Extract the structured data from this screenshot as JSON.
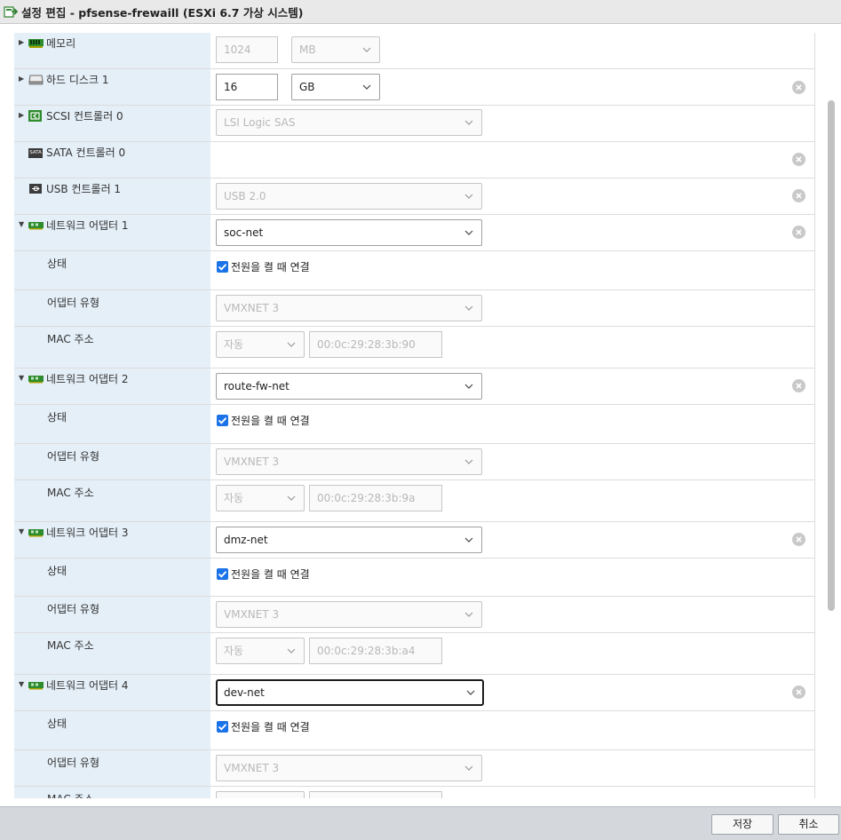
{
  "window": {
    "title": "설정 편집 - pfsense-frewaill (ESXi 6.7 가상 시스템)"
  },
  "hardware": {
    "memory": {
      "label": "메모리",
      "value": "1024",
      "unit": "MB"
    },
    "disk": {
      "label": "하드 디스크 1",
      "value": "16",
      "unit": "GB"
    },
    "scsi": {
      "label": "SCSI 컨트롤러 0",
      "value": "LSI Logic SAS"
    },
    "sata": {
      "label": "SATA 컨트롤러 0",
      "icon_text": "SATA"
    },
    "usb": {
      "label": "USB 컨트롤러 1",
      "value": "USB 2.0"
    }
  },
  "adapters": [
    {
      "label": "네트워크 어댑터 1",
      "network": "soc-net",
      "status_label": "상태",
      "connect_text": "전원을 켤 때 연결",
      "type_label": "어댑터 유형",
      "type": "VMXNET 3",
      "mac_label": "MAC 주소",
      "mac_mode": "자동",
      "mac": "00:0c:29:28:3b:90"
    },
    {
      "label": "네트워크 어댑터 2",
      "network": "route-fw-net",
      "status_label": "상태",
      "connect_text": "전원을 켤 때 연결",
      "type_label": "어댑터 유형",
      "type": "VMXNET 3",
      "mac_label": "MAC 주소",
      "mac_mode": "자동",
      "mac": "00:0c:29:28:3b:9a"
    },
    {
      "label": "네트워크 어댑터 3",
      "network": "dmz-net",
      "status_label": "상태",
      "connect_text": "전원을 켤 때 연결",
      "type_label": "어댑터 유형",
      "type": "VMXNET 3",
      "mac_label": "MAC 주소",
      "mac_mode": "자동",
      "mac": "00:0c:29:28:3b:a4"
    },
    {
      "label": "네트워크 어댑터 4",
      "network": "dev-net",
      "status_label": "상태",
      "connect_text": "전원을 켤 때 연결",
      "type_label": "어댑터 유형",
      "type": "VMXNET 3",
      "mac_label": "MAC 주소"
    }
  ],
  "footer": {
    "save_label": "저장",
    "cancel_label": "취소"
  },
  "colors": {
    "label_bg": "#e4eff8",
    "checkbox": "#1a73e8",
    "footer_bg": "#d4d8dd",
    "titlebar_bg": "#e9e9e9"
  }
}
